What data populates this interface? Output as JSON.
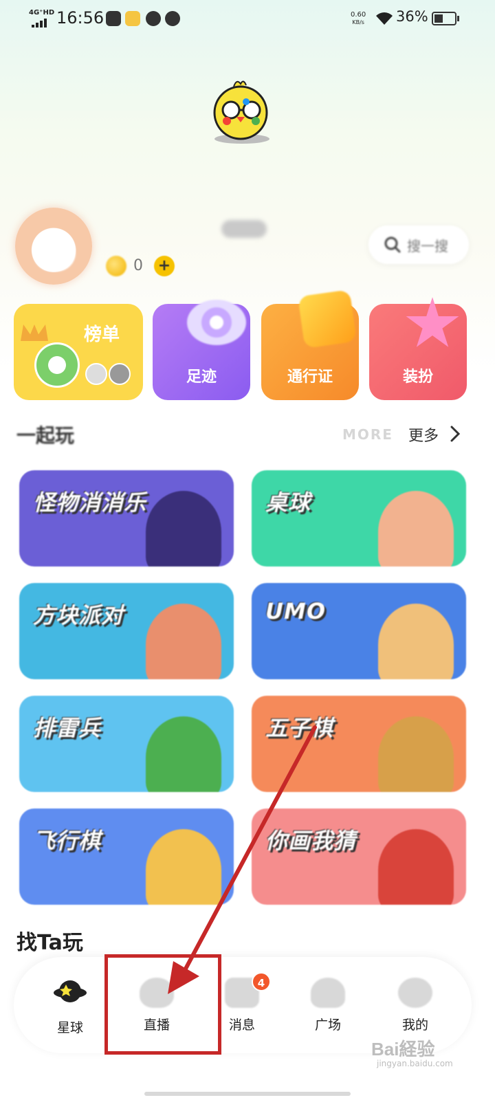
{
  "status_bar": {
    "network": "4G⁺HD",
    "time": "16:56",
    "speed_value": "0.60",
    "speed_unit": "KB/s",
    "battery": "36%"
  },
  "profile": {
    "coins": "0",
    "plus": "+",
    "search_label": "搜一搜"
  },
  "features": {
    "rank": "榜单",
    "footprint": "足迹",
    "pass": "通行证",
    "dress": "装扮"
  },
  "play_together": {
    "title": "一起玩",
    "more_en": "MORE",
    "more_cn": "更多",
    "games": [
      {
        "name": "怪物消消乐",
        "color": "#6b5fd6"
      },
      {
        "name": "桌球",
        "color": "#3ed7a7"
      },
      {
        "name": "方块派对",
        "color": "#44b8e2"
      },
      {
        "name": "UMO",
        "color": "#4a82e6"
      },
      {
        "name": "排雷兵",
        "color": "#5fc3f0"
      },
      {
        "name": "五子棋",
        "color": "#f58a5a"
      },
      {
        "name": "飞行棋",
        "color": "#5f8df0"
      },
      {
        "name": "你画我猜",
        "color": "#f58d8d"
      }
    ]
  },
  "find_ta": {
    "title": "找Ta玩"
  },
  "bottom_nav": {
    "items": [
      {
        "label": "星球",
        "icon": "planet-icon"
      },
      {
        "label": "直播",
        "icon": "live-icon"
      },
      {
        "label": "消息",
        "icon": "message-icon",
        "badge": "4"
      },
      {
        "label": "广场",
        "icon": "square-icon"
      },
      {
        "label": "我的",
        "icon": "mine-icon"
      }
    ]
  },
  "watermark": {
    "text": "Bai経验",
    "sub": "jingyan.baidu.com"
  },
  "colors": {
    "annotation": "#c62828",
    "badge": "#f2572b",
    "accent_yellow": "#fcd84a"
  }
}
